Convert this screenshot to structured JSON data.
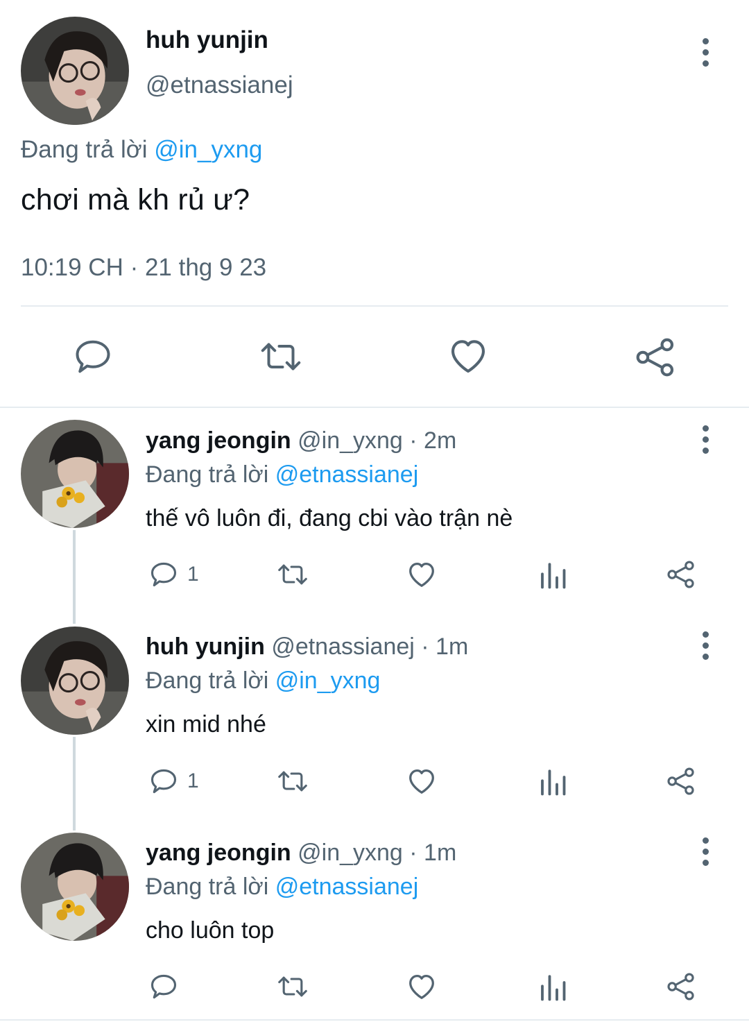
{
  "main_tweet": {
    "name": "huh yunjin",
    "handle": "@etnassianej",
    "replying_prefix": "Đang trả lời",
    "replying_to": "@in_yxng",
    "text": "chơi mà kh rủ ư?",
    "timestamp": "10:19 CH · 21 thg 9 23",
    "actions": [
      "reply-icon",
      "retweet-icon",
      "like-icon",
      "share-icon"
    ]
  },
  "replies": [
    {
      "name": "yang jeongin",
      "handle_time": "@in_yxng · 2m",
      "replying_prefix": "Đang trả lời",
      "replying_to": "@etnassianej",
      "text": "thế vô luôn đi, đang cbi vào trận nè",
      "reply_count": "1"
    },
    {
      "name": "huh yunjin",
      "handle_time": "@etnassianej · 1m",
      "replying_prefix": "Đang trả lời",
      "replying_to": "@in_yxng",
      "text": "xin mid nhé",
      "reply_count": "1"
    },
    {
      "name": "yang jeongin",
      "handle_time": "@in_yxng · 1m",
      "replying_prefix": "Đang trả lời",
      "replying_to": "@etnassianej",
      "text": "cho luôn top",
      "reply_count": ""
    }
  ],
  "colors": {
    "link_blue": "#1d9bf0",
    "secondary_gray": "#536471",
    "divider": "#e6ecf0"
  }
}
